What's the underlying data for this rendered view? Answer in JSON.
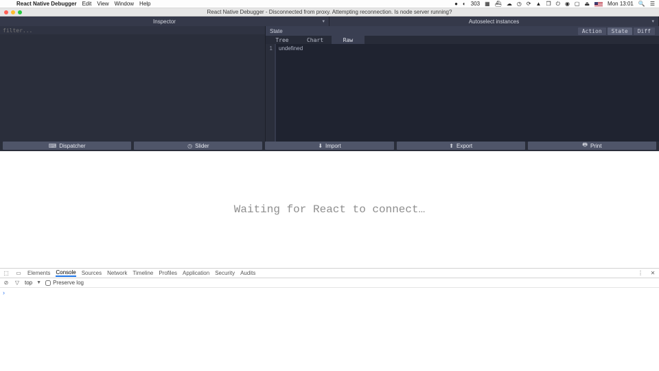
{
  "menubar": {
    "app_name": "React Native Debugger",
    "items": [
      "Edit",
      "View",
      "Window",
      "Help"
    ],
    "status_number": "303",
    "clock": "Mon 13:01"
  },
  "window": {
    "title": "React Native Debugger - Disconnected from proxy. Attempting reconnection. Is node server running?"
  },
  "panels": {
    "inspector": {
      "label": "Inspector",
      "filter_placeholder": "filter..."
    },
    "instances": {
      "label": "Autoselect instances"
    }
  },
  "state_bar": {
    "label": "State",
    "modes": {
      "action": "Action",
      "state": "State",
      "diff": "Diff",
      "active": "state"
    }
  },
  "sub_tabs": {
    "tree": "Tree",
    "chart": "Chart",
    "raw": "Raw",
    "active": "raw"
  },
  "editor": {
    "line_no": "1",
    "content": "undefined"
  },
  "toolbar": {
    "dispatcher": "Dispatcher",
    "slider": "Slider",
    "import": "Import",
    "export": "Export",
    "print": "Print"
  },
  "waiting": {
    "message": "Waiting for React to connect…"
  },
  "devtools": {
    "tabs": [
      "Elements",
      "Console",
      "Sources",
      "Network",
      "Timeline",
      "Profiles",
      "Application",
      "Security",
      "Audits"
    ],
    "active_tab": "Console",
    "context": "top",
    "preserve_log_label": "Preserve log"
  }
}
